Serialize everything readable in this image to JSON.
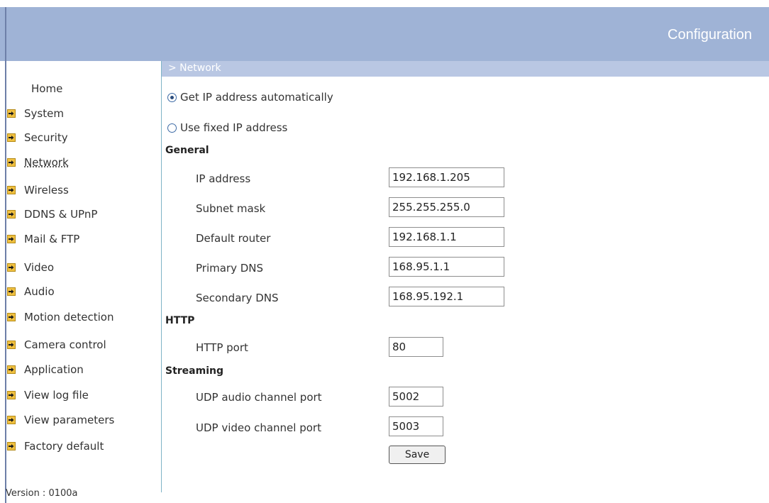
{
  "header": {
    "title": "Configuration"
  },
  "section": {
    "title": "> Network"
  },
  "sidebar": {
    "home_label": "Home",
    "items": [
      {
        "label": "System"
      },
      {
        "label": "Security"
      },
      {
        "label": "Network"
      },
      {
        "label": "Wireless"
      },
      {
        "label": "DDNS & UPnP"
      },
      {
        "label": "Mail & FTP"
      },
      {
        "label": "Video"
      },
      {
        "label": "Audio"
      },
      {
        "label": "Motion detection"
      },
      {
        "label": "Camera control"
      },
      {
        "label": "Application"
      },
      {
        "label": "View log file"
      },
      {
        "label": "View parameters"
      },
      {
        "label": "Factory default"
      }
    ],
    "current": "Network",
    "version": "Version : 0100a"
  },
  "ip_mode": {
    "auto_label": "Get IP address automatically",
    "fixed_label": "Use fixed IP address",
    "selected": "auto"
  },
  "general": {
    "title": "General",
    "ip_label": "IP address",
    "ip_value": "192.168.1.205",
    "subnet_label": "Subnet mask",
    "subnet_value": "255.255.255.0",
    "router_label": "Default router",
    "router_value": "192.168.1.1",
    "dns1_label": "Primary DNS",
    "dns1_value": "168.95.1.1",
    "dns2_label": "Secondary DNS",
    "dns2_value": "168.95.192.1"
  },
  "http": {
    "title": "HTTP",
    "port_label": "HTTP port",
    "port_value": "80"
  },
  "streaming": {
    "title": "Streaming",
    "audio_label": "UDP audio channel port",
    "audio_value": "5002",
    "video_label": "UDP video channel port",
    "video_value": "5003"
  },
  "actions": {
    "save_label": "Save"
  },
  "colors": {
    "header_bg": "#9fb3d6",
    "section_bar_bg": "#b9c7e3",
    "nav_arrow": "#f0c040"
  }
}
